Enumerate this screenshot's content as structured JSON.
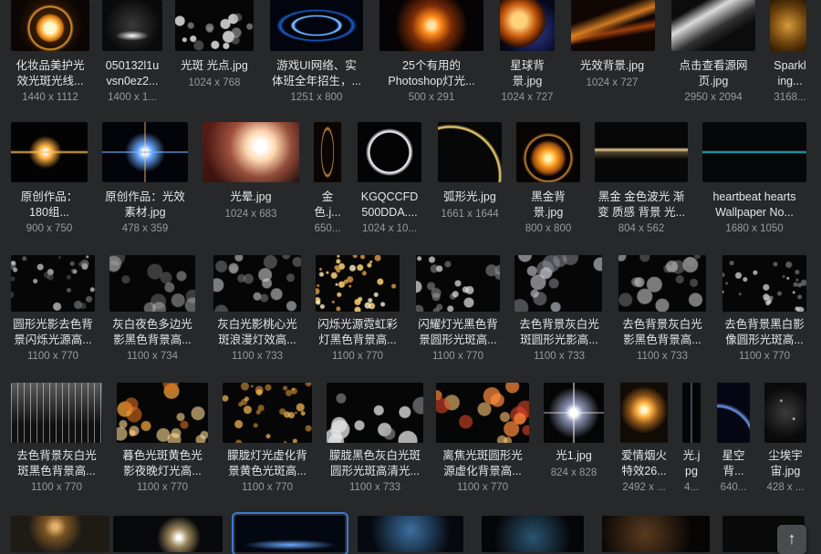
{
  "theme": {
    "background": "#27282a",
    "text": "#e6e6e6",
    "subtext": "#9a9a9a",
    "selection": "#3a7bd5"
  },
  "files": [
    {
      "name": "化妆品美护光\n效光斑光线...",
      "dims": "1440 x 1112",
      "art": "ring-gold"
    },
    {
      "name": "050132l1u\nvsn0ez2...",
      "dims": "1400 x 1...",
      "art": "flare-white"
    },
    {
      "name": "光斑 光点.jpg",
      "dims": "1024 x 768",
      "art": "bokeh-white"
    },
    {
      "name": "游戏UI网络、实\n体班全年招生，...",
      "dims": "1251 x 800",
      "art": "swirl-blue"
    },
    {
      "name": "25个有用的\nPhotoshop灯光...",
      "dims": "500 x 291",
      "art": "orange-glow"
    },
    {
      "name": "星球背\n景.jpg",
      "dims": "1024 x 727",
      "art": "planet"
    },
    {
      "name": "光效背景.jpg",
      "dims": "1024 x 727",
      "art": "orange-streak"
    },
    {
      "name": "点击查看源网\n页.jpg",
      "dims": "2950 x 2094",
      "art": "light-beam"
    },
    {
      "name": "Sparkl\ning...",
      "dims": "3168...",
      "art": "gold-sparkle"
    },
    {
      "name": "原创作品：\n180组...",
      "dims": "900 x 750",
      "art": "gold-flare-line"
    },
    {
      "name": "原创作品：光效\n素材.jpg",
      "dims": "478 x 359",
      "art": "blue-star-flare"
    },
    {
      "name": "光晕.jpg",
      "dims": "1024 x 683",
      "art": "lens-halo"
    },
    {
      "name": "金\n色.j...",
      "dims": "650...",
      "art": "gold-swirl"
    },
    {
      "name": "KGQCCFD\n500DDA....",
      "dims": "1024 x 10...",
      "art": "white-ring"
    },
    {
      "name": "弧形光.jpg",
      "dims": "1661 x 1644",
      "art": "arc-light"
    },
    {
      "name": "黑金背\n景.jpg",
      "dims": "800 x 800",
      "art": "gold-ring-burst"
    },
    {
      "name": "黑金 金色波光 渐\n变 质感 背景 光...",
      "dims": "804 x 562",
      "art": "horizon-gold"
    },
    {
      "name": "heartbeat hearts\nWallpaper No...",
      "dims": "1680 x 1050",
      "art": "heartbeat"
    },
    {
      "name": "圆形光影去色背\n景闪烁光源高...",
      "dims": "1100 x 770",
      "art": "bokeh-gray"
    },
    {
      "name": "灰白夜色多边光\n影黑色背景高...",
      "dims": "1100 x 734",
      "art": "bokeh-gray2"
    },
    {
      "name": "灰白光影桃心光\n斑浪漫灯效高...",
      "dims": "1100 x 733",
      "art": "bokeh-heart"
    },
    {
      "name": "闪烁光源霓虹彩\n灯黑色背景高...",
      "dims": "1100 x 770",
      "art": "bokeh-gold-dots"
    },
    {
      "name": "闪耀灯光黑色背\n景圆形光斑高...",
      "dims": "1100 x 770",
      "art": "bokeh-gray3"
    },
    {
      "name": "去色背景灰白光\n斑圆形光影高...",
      "dims": "1100 x 733",
      "art": "bokeh-gray4"
    },
    {
      "name": "去色背景灰白光\n影黑色背景高...",
      "dims": "1100 x 733",
      "art": "bokeh-gray5"
    },
    {
      "name": "去色背景黑白影\n像圆形光斑高...",
      "dims": "1100 x 770",
      "art": "bokeh-tree"
    },
    {
      "name": "去色背景灰白光\n斑黑色背景高...",
      "dims": "1100 x 770",
      "art": "rain-streaks"
    },
    {
      "name": "暮色光斑黄色光\n影夜晚灯光高...",
      "dims": "1100 x 770",
      "art": "bokeh-amber"
    },
    {
      "name": "朦胧灯光虚化背\n景黄色光斑高...",
      "dims": "1100 x 770",
      "art": "bokeh-amber2"
    },
    {
      "name": "朦胧黑色灰白光斑\n圆形光斑高清光...",
      "dims": "1100 x 733",
      "art": "bokeh-gray6"
    },
    {
      "name": "离焦光斑圆形光\n源虚化背景高...",
      "dims": "1100 x 770",
      "art": "bokeh-red"
    },
    {
      "name": "光1.jpg",
      "dims": "824 x 828",
      "art": "star-white"
    },
    {
      "name": "爱情烟火\n特效26...",
      "dims": "2492 x ...",
      "art": "sparkler"
    },
    {
      "name": "光.j\npg",
      "dims": "4...",
      "art": "thin-beam"
    },
    {
      "name": "星空\n背...",
      "dims": "640...",
      "art": "space-arc"
    },
    {
      "name": "尘埃宇\n宙.jpg",
      "dims": "428 x ...",
      "art": "dust"
    },
    {
      "name": "",
      "dims": "",
      "art": "row5-a"
    },
    {
      "name": "",
      "dims": "",
      "art": "row5-b"
    },
    {
      "name": "",
      "dims": "",
      "art": "row5-c"
    },
    {
      "name": "",
      "dims": "",
      "art": "row5-d"
    },
    {
      "name": "",
      "dims": "",
      "art": "row5-e"
    },
    {
      "name": "",
      "dims": "",
      "art": "row5-f"
    },
    {
      "name": "",
      "dims": "",
      "art": "row5-g"
    }
  ],
  "scroll_top_button": {
    "icon": "arrow-up-icon",
    "glyph": "↑"
  }
}
